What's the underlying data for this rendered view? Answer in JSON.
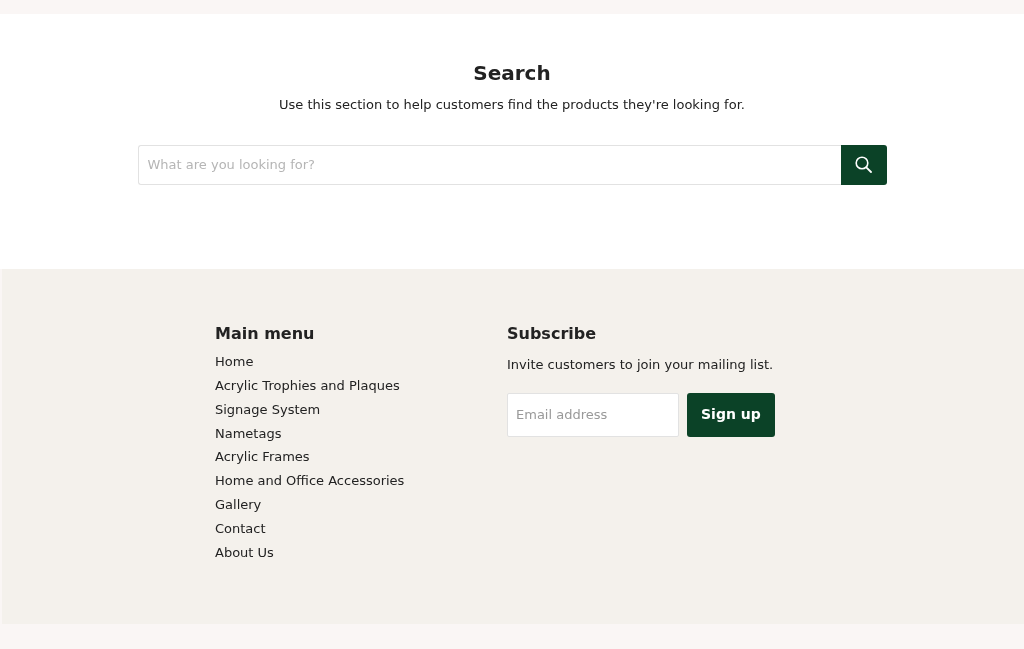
{
  "search": {
    "title": "Search",
    "description": "Use this section to help customers find the products they're looking for.",
    "placeholder": "What are you looking for?"
  },
  "footer": {
    "menu": {
      "title": "Main menu",
      "items": [
        "Home",
        "Acrylic Trophies and Plaques",
        "Signage System",
        "Nametags",
        "Acrylic Frames",
        "Home and Office Accessories",
        "Gallery",
        "Contact",
        "About Us"
      ]
    },
    "subscribe": {
      "title": "Subscribe",
      "description": "Invite customers to join your mailing list.",
      "placeholder": "Email address",
      "button": "Sign up"
    }
  }
}
